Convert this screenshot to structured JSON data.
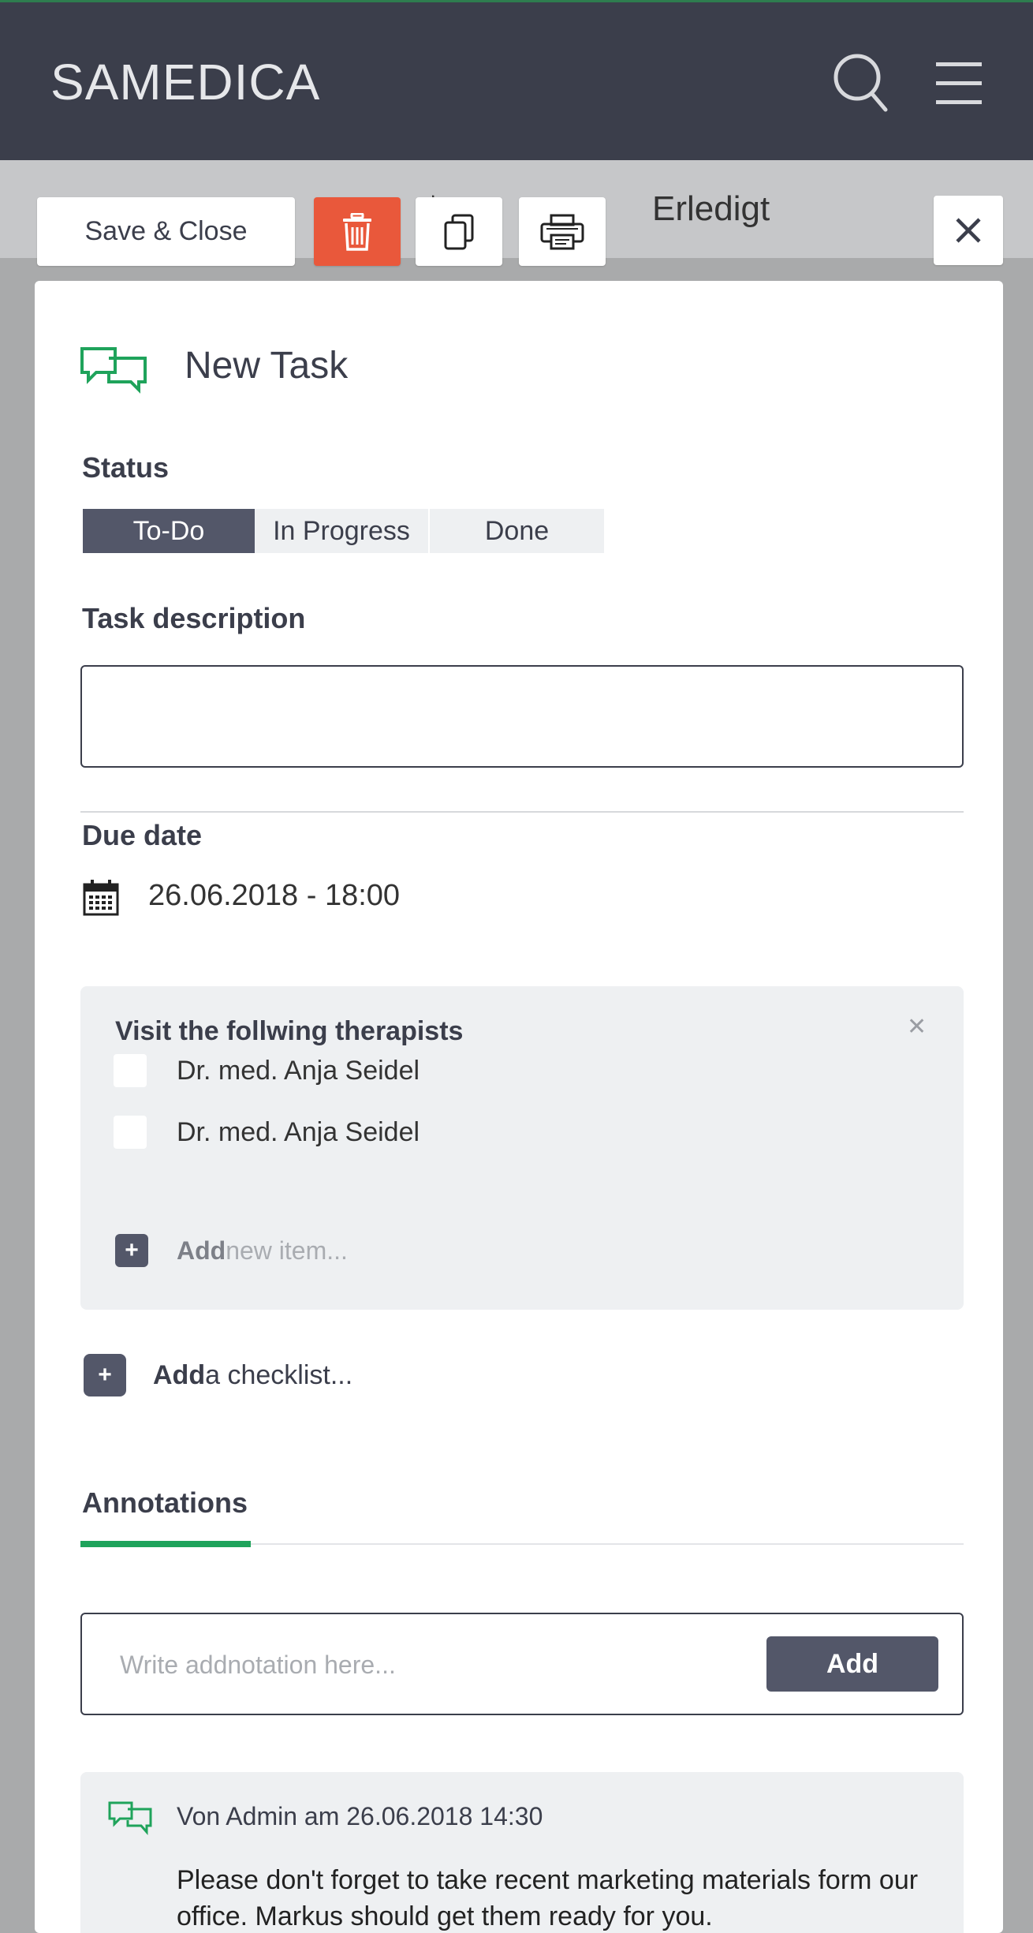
{
  "header": {
    "brand": "SAMEDICA",
    "search_icon": "search-icon",
    "menu_icon": "hamburger-menu-icon"
  },
  "background_strip": {
    "partial_label": "Offen e",
    "done_label": "Erledigt"
  },
  "toolbar": {
    "save_close_label": "Save & Close",
    "delete_icon": "trash-icon",
    "copy_icon": "copy-icon",
    "print_icon": "printer-icon",
    "close_icon": "close-icon"
  },
  "task": {
    "title": "New Task",
    "status_label": "Status",
    "status_options": [
      "To-Do",
      "In Progress",
      "Done"
    ],
    "status_selected": "To-Do",
    "description_label": "Task description",
    "description_value": "",
    "due_label": "Due date",
    "due_value": "26.06.2018  - 18:00"
  },
  "checklist": {
    "title": "Visit the follwing therapists",
    "items": [
      {
        "label": "Dr. med. Anja Seidel",
        "checked": false
      },
      {
        "label": "Dr. med. Anja Seidel",
        "checked": false
      }
    ],
    "add_item_bold": "Add",
    "add_item_rest": " new item..."
  },
  "add_checklist": {
    "bold": "Add",
    "rest": " a checklist..."
  },
  "annotations": {
    "title": "Annotations",
    "input_placeholder": "Write addnotation here...",
    "add_label": "Add",
    "comments": [
      {
        "meta": "Von Admin am 26.06.2018 14:30",
        "body": "Please don't forget to take recent marketing materials form our office. Markus should get them ready for you."
      }
    ]
  },
  "colors": {
    "header_bg": "#3b3e4b",
    "delete_red": "#e9583b",
    "accent_green": "#1fa35b",
    "segment_active": "#535769"
  }
}
